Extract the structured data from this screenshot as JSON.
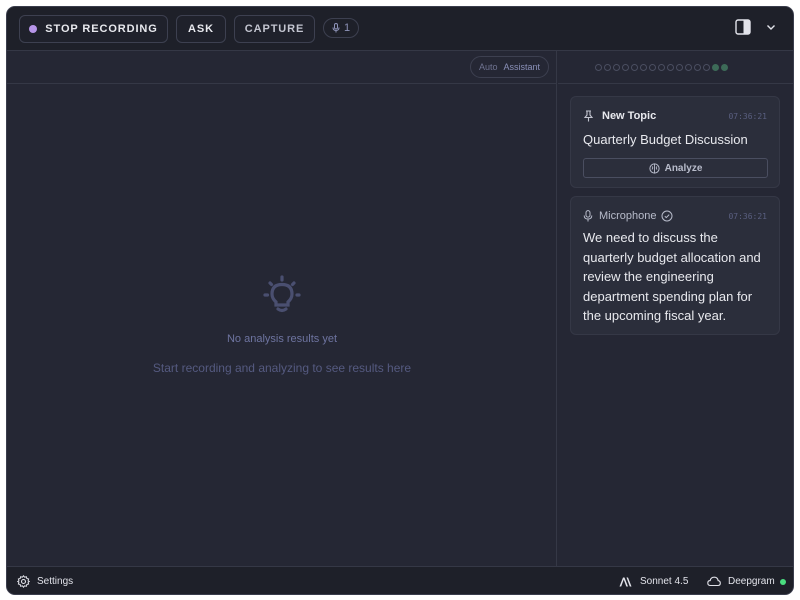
{
  "toolbar": {
    "stop_recording_label": "STOP RECORDING",
    "ask_label": "ASK",
    "capture_label": "CAPTURE",
    "mic_count": "1"
  },
  "left_panel": {
    "mode_auto": "Auto",
    "mode_assistant": "Assistant",
    "empty_title": "No analysis results yet",
    "empty_subtitle": "Start recording and analyzing to see results here"
  },
  "right_panel": {
    "progress_dots": [
      false,
      false,
      false,
      false,
      false,
      false,
      false,
      false,
      false,
      false,
      false,
      false,
      false,
      true,
      true
    ],
    "topic_card": {
      "label": "New Topic",
      "time": "07:36:21",
      "text": "Quarterly Budget Discussion",
      "analyze_label": "Analyze"
    },
    "mic_card": {
      "label": "Microphone",
      "time": "07:36:21",
      "text": "We need to discuss the quarterly budget allocation and review the engineering department spending plan for the upcoming fiscal year."
    }
  },
  "statusbar": {
    "settings_label": "Settings",
    "model_label": "Sonnet 4.5",
    "stt_label": "Deepgram",
    "stt_status_color": "#4ade80"
  },
  "colors": {
    "background": "#252734",
    "toolbar": "#1e2029",
    "recording_dot": "#b695e8",
    "active_dot": "#3d6b58"
  }
}
